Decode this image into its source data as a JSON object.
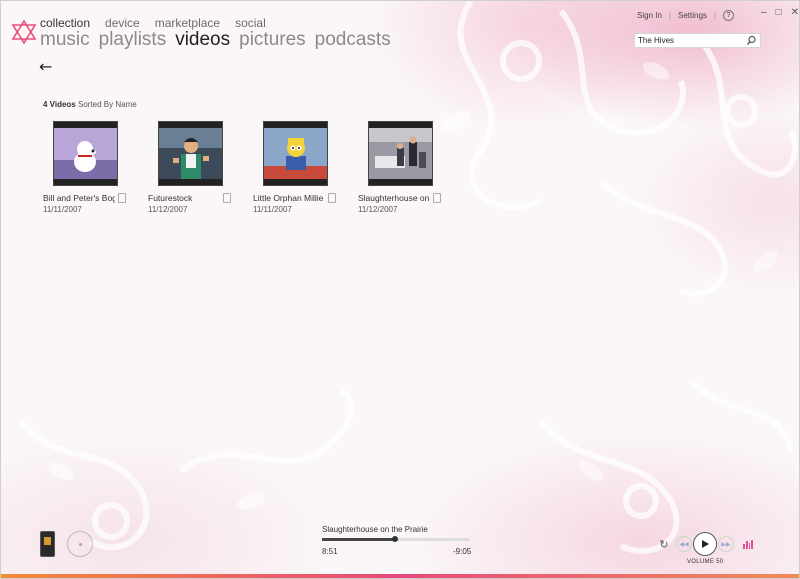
{
  "nav": {
    "pivots": [
      "collection",
      "device",
      "marketplace",
      "social"
    ],
    "active_pivot": "collection",
    "sections": [
      "music",
      "playlists",
      "videos",
      "pictures",
      "podcasts"
    ],
    "active_section": "videos",
    "back_icon": "back-arrow-icon"
  },
  "top": {
    "sign_in": "Sign In",
    "settings": "Settings",
    "help": "?",
    "window_controls": [
      "–",
      "□",
      "✕"
    ]
  },
  "search": {
    "value": "The Hives"
  },
  "list": {
    "count_label": "4 Videos",
    "sort_label": "Sorted By Name"
  },
  "videos": [
    {
      "title": "Bill and Peter's Bog",
      "date": "11/11/2007"
    },
    {
      "title": "Futurestock",
      "date": "11/12/2007"
    },
    {
      "title": "Little Orphan Millie",
      "date": "11/11/2007"
    },
    {
      "title": "Slaughterhouse on",
      "date": "11/12/2007"
    }
  ],
  "player": {
    "now_playing": "Slaughterhouse on the Prairie",
    "elapsed": "8:51",
    "remaining": "-9:05",
    "progress": 0.49,
    "volume_label": "VOLUME 50"
  },
  "colors": {
    "accent": "#e84a7a",
    "bar_start": "#f28a3a"
  }
}
